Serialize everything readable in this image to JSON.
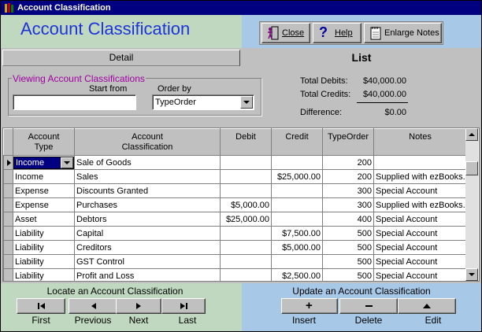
{
  "window": {
    "title": "Account Classification"
  },
  "header": {
    "title": "Account Classification",
    "close_label": "Close",
    "help_label": "Help",
    "enlarge_label": "Enlarge Notes"
  },
  "tabs": {
    "detail": "Detail",
    "list": "List"
  },
  "viewing": {
    "group_label": "Viewing Account Classifications",
    "start_from_label": "Start from",
    "start_from_value": "",
    "order_by_label": "Order by",
    "order_by_value": "TypeOrder"
  },
  "totals": {
    "debits_label": "Total Debits:",
    "debits_value": "$40,000.00",
    "credits_label": "Total Credits:",
    "credits_value": "$40,000.00",
    "difference_label": "Difference:",
    "difference_value": "$0.00"
  },
  "table": {
    "columns": {
      "type": "Account\nType",
      "classification": "Account\nClassification",
      "debit": "Debit",
      "credit": "Credit",
      "typeorder": "TypeOrder",
      "notes": "Notes"
    },
    "rows": [
      {
        "type": "Income",
        "classification": "Sale of Goods",
        "debit": "",
        "credit": "",
        "typeorder": "200",
        "notes": ""
      },
      {
        "type": "Income",
        "classification": "Sales",
        "debit": "",
        "credit": "$25,000.00",
        "typeorder": "200",
        "notes": "Supplied with ezBooks."
      },
      {
        "type": "Expense",
        "classification": "Discounts Granted",
        "debit": "",
        "credit": "",
        "typeorder": "300",
        "notes": "Special Account"
      },
      {
        "type": "Expense",
        "classification": "Purchases",
        "debit": "$5,000.00",
        "credit": "",
        "typeorder": "300",
        "notes": "Supplied with ezBooks."
      },
      {
        "type": "Asset",
        "classification": "Debtors",
        "debit": "$25,000.00",
        "credit": "",
        "typeorder": "400",
        "notes": "Special Account"
      },
      {
        "type": "Liability",
        "classification": "Capital",
        "debit": "",
        "credit": "$7,500.00",
        "typeorder": "500",
        "notes": "Special Account"
      },
      {
        "type": "Liability",
        "classification": "Creditors",
        "debit": "",
        "credit": "$5,000.00",
        "typeorder": "500",
        "notes": "Special Account"
      },
      {
        "type": "Liability",
        "classification": "GST Control",
        "debit": "",
        "credit": "",
        "typeorder": "500",
        "notes": "Special Account"
      },
      {
        "type": "Liability",
        "classification": "Profit and Loss",
        "debit": "",
        "credit": "$2,500.00",
        "typeorder": "500",
        "notes": "Special Account"
      }
    ]
  },
  "locate": {
    "title": "Locate an Account Classification",
    "first": "First",
    "previous": "Previous",
    "next": "Next",
    "last": "Last"
  },
  "update": {
    "title": "Update an Account Classification",
    "insert": "Insert",
    "delete": "Delete",
    "edit": "Edit"
  },
  "colors": {
    "title_bar": "#000080",
    "header_left": "#c0d8c0",
    "header_right": "#a8c8e8",
    "title_text": "#1c34d8",
    "group_label": "#a000a0"
  }
}
